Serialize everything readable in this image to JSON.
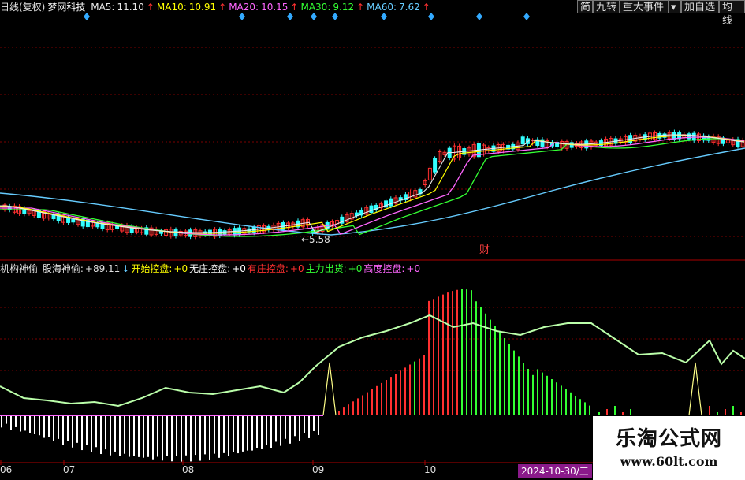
{
  "header": {
    "period": "日线(复权)",
    "stock_name": "梦网科技",
    "ma": [
      {
        "label": "MA5:",
        "value": "11.10",
        "arrow": "↑",
        "color": "#e8e8e8"
      },
      {
        "label": "MA10:",
        "value": "10.91",
        "arrow": "↑",
        "color": "#ffff00"
      },
      {
        "label": "MA20:",
        "value": "10.15",
        "arrow": "↑",
        "color": "#ff66ff"
      },
      {
        "label": "MA30:",
        "value": "9.12",
        "arrow": "↑",
        "color": "#33ff33"
      },
      {
        "label": "MA60:",
        "value": "7.62",
        "arrow": "↑",
        "color": "#66ccff"
      }
    ]
  },
  "toolbar": {
    "btn_jian": "简",
    "btn_jiuzhuan": "九转",
    "btn_events": "重大事件",
    "btn_dropdown": "▾",
    "btn_add": "加自选",
    "btn_ma": "均线"
  },
  "main_chart": {
    "low_label": "←5.58",
    "finance_marker": "财"
  },
  "indicator": {
    "name": "机构神偷",
    "items": [
      {
        "label": "股海神偷:",
        "value": "+89.11",
        "arrow": "↓",
        "color": "#e0e0e0",
        "arrow_color": "#66ccff"
      },
      {
        "label": "开始控盘:",
        "value": "+0",
        "color": "#ffff00"
      },
      {
        "label": "无庄控盘:",
        "value": "+0",
        "color": "#ffffff"
      },
      {
        "label": "有庄控盘:",
        "value": "+0",
        "color": "#ff3030"
      },
      {
        "label": "主力出货:",
        "value": "+0",
        "color": "#33ff33"
      },
      {
        "label": "高度控盘:",
        "value": "+0",
        "color": "#ff66ff"
      }
    ]
  },
  "x_axis": {
    "labels": [
      "06",
      "07",
      "08",
      "09",
      "10"
    ],
    "cursor_date": "2024-10-30/三"
  },
  "watermark": {
    "title": "乐淘公式网",
    "url": "www.60lt.com"
  },
  "colors": {
    "up": "#ff3030",
    "down": "#33ffff",
    "grid": "#7a0000",
    "volume_up": "#ff3030",
    "volume_down": "#33ff33",
    "neg_bar": "#ffffff",
    "osc_line": "#bbffaa"
  }
}
